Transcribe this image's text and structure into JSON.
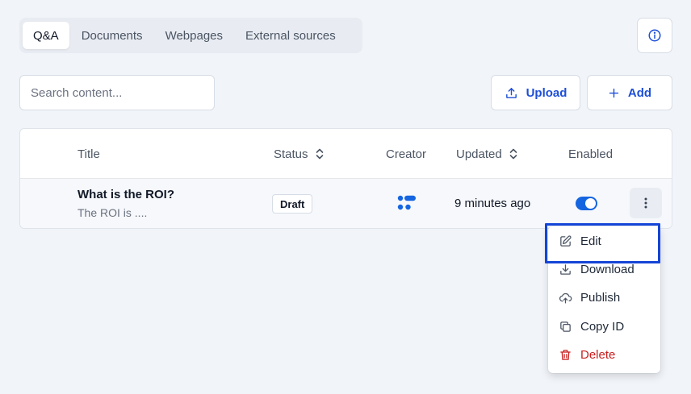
{
  "tabs": [
    {
      "label": "Q&A",
      "active": true
    },
    {
      "label": "Documents",
      "active": false
    },
    {
      "label": "Webpages",
      "active": false
    },
    {
      "label": "External sources",
      "active": false
    }
  ],
  "search": {
    "placeholder": "Search content..."
  },
  "actions": {
    "upload_label": "Upload",
    "add_label": "Add"
  },
  "table": {
    "columns": {
      "title": "Title",
      "status": "Status",
      "creator": "Creator",
      "updated": "Updated",
      "enabled": "Enabled"
    },
    "rows": [
      {
        "title": "What is the ROI?",
        "subtitle": "The ROI is ....",
        "status": "Draft",
        "updated": "9 minutes ago",
        "enabled": true
      }
    ]
  },
  "row_menu": {
    "items": [
      {
        "label": "Edit",
        "icon": "pencil-square-icon"
      },
      {
        "label": "Download",
        "icon": "download-icon"
      },
      {
        "label": "Publish",
        "icon": "cloud-upload-icon"
      },
      {
        "label": "Copy ID",
        "icon": "copy-icon"
      },
      {
        "label": "Delete",
        "icon": "trash-icon"
      }
    ]
  },
  "colors": {
    "accent": "#1d4ed8",
    "toggle_on": "#1565e0",
    "danger": "#c81e1e"
  }
}
